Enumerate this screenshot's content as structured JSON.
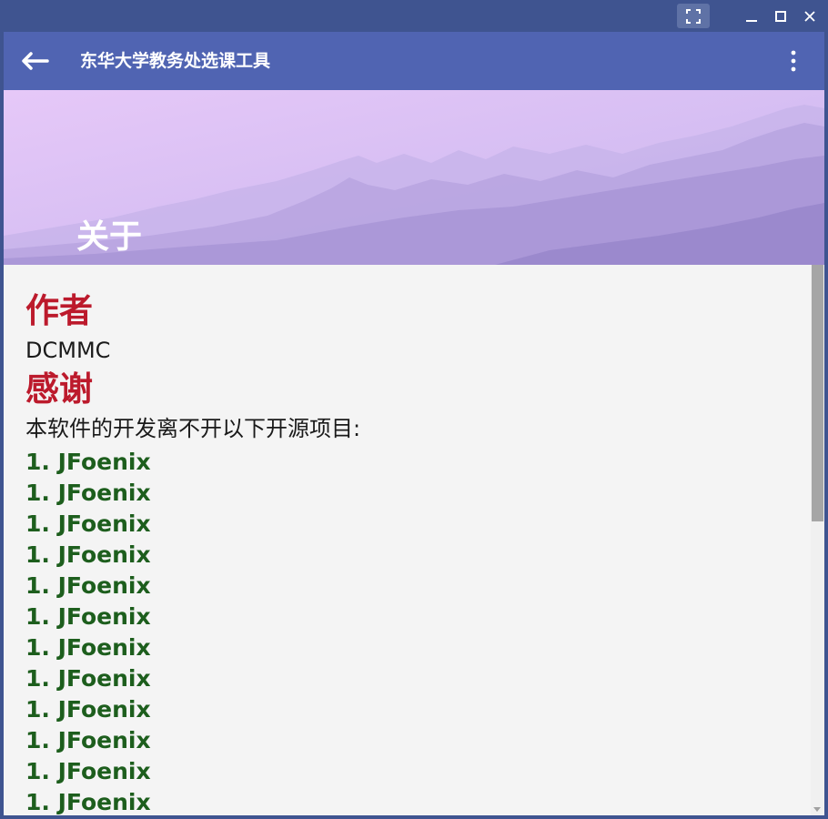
{
  "window": {
    "controls": {
      "fullscreen_icon": "fullscreen-icon",
      "minimize_icon": "minimize-icon",
      "maximize_icon": "maximize-icon",
      "close_icon": "close-icon"
    }
  },
  "toolbar": {
    "title": "东华大学教务处选课工具",
    "back_icon": "arrow-left-icon",
    "menu_icon": "more-vertical-icon"
  },
  "banner": {
    "title": "关于"
  },
  "content": {
    "author_heading": "作者",
    "author_name": "DCMMC",
    "thanks_heading": "感谢",
    "thanks_text": "本软件的开发离不开以下开源项目:",
    "projects": [
      "1. JFoenix",
      "1. JFoenix",
      "1. JFoenix",
      "1. JFoenix",
      "1. JFoenix",
      "1. JFoenix",
      "1. JFoenix",
      "1. JFoenix",
      "1. JFoenix",
      "1. JFoenix",
      "1. JFoenix",
      "1. JFoenix"
    ]
  },
  "colors": {
    "titlebar": "#3f5490",
    "toolbar": "#5064b2",
    "heading": "#bc1a2c",
    "project": "#1d5e1d",
    "background": "#f4f4f4"
  }
}
